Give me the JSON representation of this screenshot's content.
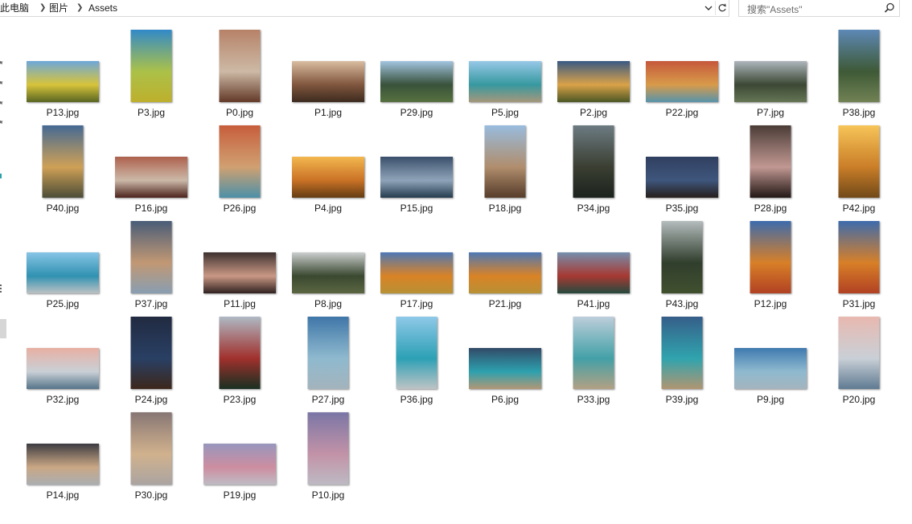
{
  "breadcrumb": [
    "此电脑",
    "图片",
    "Assets"
  ],
  "search": {
    "placeholder": "搜索\"Assets\""
  },
  "icons": {
    "dropdown": "chevron-down-icon",
    "refresh": "refresh-icon",
    "search": "search-icon",
    "separator": "chevron-right-icon"
  },
  "files": [
    {
      "name": "P13.jpg",
      "orientation": "landscape",
      "colors": [
        "#5f9fd8",
        "#f0d93a",
        "#6d7c2a"
      ]
    },
    {
      "name": "P3.jpg",
      "orientation": "portrait",
      "colors": [
        "#1f7fc4",
        "#bdd64a",
        "#e7d636"
      ]
    },
    {
      "name": "P0.jpg",
      "orientation": "portrait",
      "colors": [
        "#b0775a",
        "#e3cdb6",
        "#7a4631"
      ]
    },
    {
      "name": "P1.jpg",
      "orientation": "landscape",
      "colors": [
        "#d7b89a",
        "#8b5a3e",
        "#4a3426"
      ]
    },
    {
      "name": "P29.jpg",
      "orientation": "landscape",
      "colors": [
        "#9bc0df",
        "#37553a",
        "#6a8a4d"
      ]
    },
    {
      "name": "P5.jpg",
      "orientation": "landscape",
      "colors": [
        "#8fc4e6",
        "#36a7b0",
        "#c9b896"
      ]
    },
    {
      "name": "P2.jpg",
      "orientation": "landscape",
      "colors": [
        "#274a78",
        "#f2b24a",
        "#5c6a2c"
      ]
    },
    {
      "name": "P22.jpg",
      "orientation": "landscape",
      "colors": [
        "#c0482a",
        "#f0aa4c",
        "#6bb4d0"
      ]
    },
    {
      "name": "P7.jpg",
      "orientation": "landscape",
      "colors": [
        "#a7b0b8",
        "#3c4a33",
        "#7a8e66"
      ]
    },
    {
      "name": "P38.jpg",
      "orientation": "portrait",
      "colors": [
        "#4f7eb0",
        "#3e5e35",
        "#8a9e66"
      ]
    },
    {
      "name": "P40.jpg",
      "orientation": "portrait",
      "colors": [
        "#335c8a",
        "#e6b05a",
        "#5d5e43"
      ]
    },
    {
      "name": "P16.jpg",
      "orientation": "landscape",
      "colors": [
        "#a6533d",
        "#e2ccb8",
        "#5d2b22"
      ]
    },
    {
      "name": "P26.jpg",
      "orientation": "portrait",
      "colors": [
        "#c24f2a",
        "#e7b07a",
        "#5db0cc"
      ]
    },
    {
      "name": "P4.jpg",
      "orientation": "landscape",
      "colors": [
        "#f2b240",
        "#e07a22",
        "#7a4a18"
      ]
    },
    {
      "name": "P15.jpg",
      "orientation": "landscape",
      "colors": [
        "#28405e",
        "#9cb4cc",
        "#2e4a60"
      ]
    },
    {
      "name": "P18.jpg",
      "orientation": "portrait",
      "colors": [
        "#8fb6dc",
        "#c29a74",
        "#6a4a34"
      ]
    },
    {
      "name": "P34.jpg",
      "orientation": "portrait",
      "colors": [
        "#607078",
        "#3a3f30",
        "#222a24"
      ]
    },
    {
      "name": "P35.jpg",
      "orientation": "landscape",
      "colors": [
        "#1e2f52",
        "#3f5a86",
        "#2e2522"
      ]
    },
    {
      "name": "P28.jpg",
      "orientation": "portrait",
      "colors": [
        "#3a2a24",
        "#d6a6a0",
        "#2a1d1a"
      ]
    },
    {
      "name": "P42.jpg",
      "orientation": "portrait",
      "colors": [
        "#f6c04a",
        "#e08824",
        "#8a5a1e"
      ]
    },
    {
      "name": "P25.jpg",
      "orientation": "landscape",
      "colors": [
        "#7ec0e4",
        "#2f9fc4",
        "#e4ebef"
      ]
    },
    {
      "name": "P37.jpg",
      "orientation": "portrait",
      "colors": [
        "#384e6c",
        "#d6a67c",
        "#a7c0d8"
      ]
    },
    {
      "name": "P11.jpg",
      "orientation": "landscape",
      "colors": [
        "#2a1e1c",
        "#e0a690",
        "#3b2a28"
      ]
    },
    {
      "name": "P8.jpg",
      "orientation": "landscape",
      "colors": [
        "#c8cbcc",
        "#3a4a2e",
        "#6f7d50"
      ]
    },
    {
      "name": "P17.jpg",
      "orientation": "landscape",
      "colors": [
        "#3d6cb0",
        "#f28e22",
        "#e0b040"
      ]
    },
    {
      "name": "P21.jpg",
      "orientation": "landscape",
      "colors": [
        "#3d6cb0",
        "#f28e22",
        "#e0b040"
      ]
    },
    {
      "name": "P41.jpg",
      "orientation": "landscape",
      "colors": [
        "#6a86a8",
        "#b83830",
        "#2d5a4c"
      ]
    },
    {
      "name": "P43.jpg",
      "orientation": "portrait",
      "colors": [
        "#aeb7b8",
        "#2e3e2a",
        "#4e6238"
      ]
    },
    {
      "name": "P12.jpg",
      "orientation": "portrait",
      "colors": [
        "#2b5ea6",
        "#f08a24",
        "#d8502a"
      ]
    },
    {
      "name": "P31.jpg",
      "orientation": "portrait",
      "colors": [
        "#2b5ea6",
        "#f08a24",
        "#d8502a"
      ]
    },
    {
      "name": "P32.jpg",
      "orientation": "landscape",
      "colors": [
        "#e6a89a",
        "#dfe7ee",
        "#6a8ea8"
      ]
    },
    {
      "name": "P24.jpg",
      "orientation": "portrait",
      "colors": [
        "#0e1830",
        "#26406a",
        "#4a3022"
      ]
    },
    {
      "name": "P23.jpg",
      "orientation": "portrait",
      "colors": [
        "#a8b4c0",
        "#b02e2a",
        "#1e3a28"
      ]
    },
    {
      "name": "P27.jpg",
      "orientation": "portrait",
      "colors": [
        "#2e6aa0",
        "#9ccde6",
        "#c7dbe6"
      ]
    },
    {
      "name": "P36.jpg",
      "orientation": "portrait",
      "colors": [
        "#86c4e6",
        "#2ab0c8",
        "#e6eef0"
      ]
    },
    {
      "name": "P6.jpg",
      "orientation": "landscape",
      "colors": [
        "#203a5a",
        "#2ab0c0",
        "#d8b890"
      ]
    },
    {
      "name": "P33.jpg",
      "orientation": "portrait",
      "colors": [
        "#b8cad8",
        "#44b0b8",
        "#d8c4a0"
      ]
    },
    {
      "name": "P39.jpg",
      "orientation": "portrait",
      "colors": [
        "#24507e",
        "#2eb4c0",
        "#d6b68a"
      ]
    },
    {
      "name": "P9.jpg",
      "orientation": "landscape",
      "colors": [
        "#2e6ea8",
        "#9ccde6",
        "#c8dce8"
      ]
    },
    {
      "name": "P20.jpg",
      "orientation": "portrait",
      "colors": [
        "#e6b2a8",
        "#dfe7ef",
        "#7596b2"
      ]
    },
    {
      "name": "P14.jpg",
      "orientation": "landscape",
      "colors": [
        "#2a2a30",
        "#e0b890",
        "#d0d4d8"
      ]
    },
    {
      "name": "P30.jpg",
      "orientation": "portrait",
      "colors": [
        "#7c6a68",
        "#e8c49a",
        "#d0c8c4"
      ]
    },
    {
      "name": "P19.jpg",
      "orientation": "landscape",
      "colors": [
        "#8e8eb8",
        "#e49ab0",
        "#e8e4ee"
      ]
    },
    {
      "name": "P10.jpg",
      "orientation": "portrait",
      "colors": [
        "#6e6a9e",
        "#d8a0b8",
        "#e6e2ee"
      ]
    }
  ]
}
